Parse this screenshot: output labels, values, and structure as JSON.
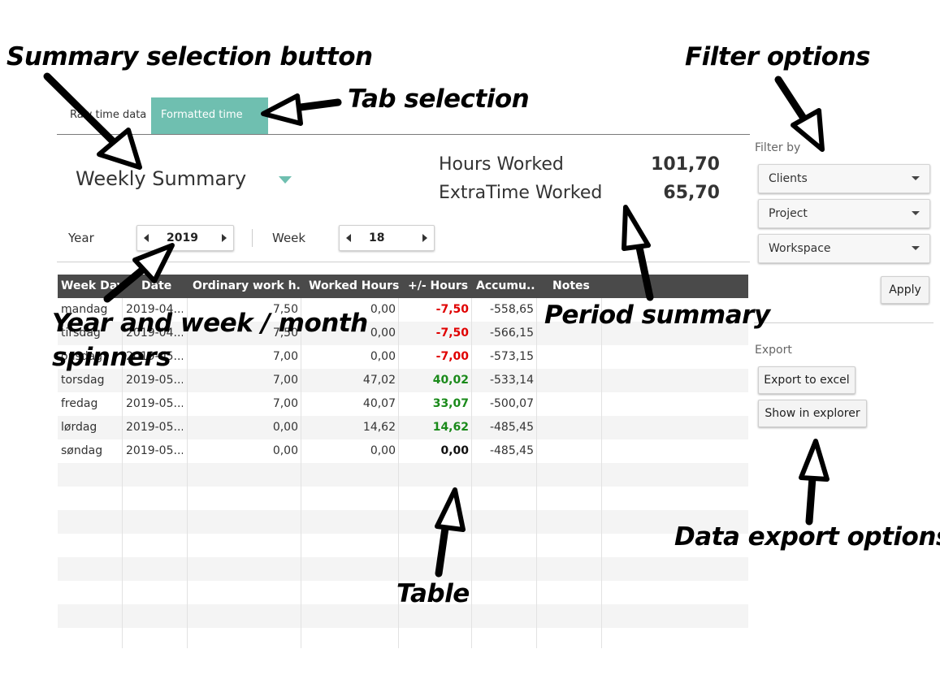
{
  "tabs": [
    {
      "label": "Raw time data",
      "active": false
    },
    {
      "label": "Formatted time data",
      "active": true
    }
  ],
  "summary_selector": {
    "value": "Weekly Summary"
  },
  "period_summary": [
    {
      "label": "Hours Worked",
      "value": "101,70"
    },
    {
      "label": "ExtraTime Worked",
      "value": "65,70"
    }
  ],
  "spinners": {
    "year": {
      "label": "Year",
      "value": "2019"
    },
    "week": {
      "label": "Week",
      "value": "18"
    }
  },
  "table": {
    "columns": [
      "Week Day",
      "Date",
      "Ordinary work h...",
      "Worked Hours",
      "+/- Hours",
      "Accumu...",
      "Notes"
    ],
    "rows": [
      {
        "day": "mandag",
        "date": "2019-04...",
        "ordinary": "7,50",
        "worked": "0,00",
        "diff": "-7,50",
        "diff_kind": "neg",
        "accum": "-558,65",
        "notes": ""
      },
      {
        "day": "tirsdag",
        "date": "2019-04...",
        "ordinary": "7,50",
        "worked": "0,00",
        "diff": "-7,50",
        "diff_kind": "neg",
        "accum": "-566,15",
        "notes": ""
      },
      {
        "day": "onsdag",
        "date": "2019-05...",
        "ordinary": "7,00",
        "worked": "0,00",
        "diff": "-7,00",
        "diff_kind": "neg",
        "accum": "-573,15",
        "notes": ""
      },
      {
        "day": "torsdag",
        "date": "2019-05...",
        "ordinary": "7,00",
        "worked": "47,02",
        "diff": "40,02",
        "diff_kind": "pos",
        "accum": "-533,14",
        "notes": ""
      },
      {
        "day": "fredag",
        "date": "2019-05...",
        "ordinary": "7,00",
        "worked": "40,07",
        "diff": "33,07",
        "diff_kind": "pos",
        "accum": "-500,07",
        "notes": ""
      },
      {
        "day": "lørdag",
        "date": "2019-05...",
        "ordinary": "0,00",
        "worked": "14,62",
        "diff": "14,62",
        "diff_kind": "pos",
        "accum": "-485,45",
        "notes": ""
      },
      {
        "day": "søndag",
        "date": "2019-05...",
        "ordinary": "0,00",
        "worked": "0,00",
        "diff": "0,00",
        "diff_kind": "zero",
        "accum": "-485,45",
        "notes": ""
      }
    ]
  },
  "filter": {
    "title": "Filter by",
    "options": [
      "Clients",
      "Project",
      "Workspace"
    ],
    "apply_label": "Apply"
  },
  "export": {
    "title": "Export",
    "excel_label": "Export to excel",
    "explorer_label": "Show in explorer"
  },
  "annotations": {
    "summary_selection_button": "Summary selection button",
    "tab_selection": "Tab selection",
    "filter_options": "Filter options",
    "period_summary": "Period summary",
    "spinners_line1": "Year and week / month",
    "spinners_line2": "spinners",
    "data_export_options": "Data export options",
    "table": "Table"
  },
  "colors": {
    "accent": "#6fbfb0",
    "header_bg": "#4a4a4a",
    "negative": "#e00000",
    "positive": "#1a8a1a"
  }
}
